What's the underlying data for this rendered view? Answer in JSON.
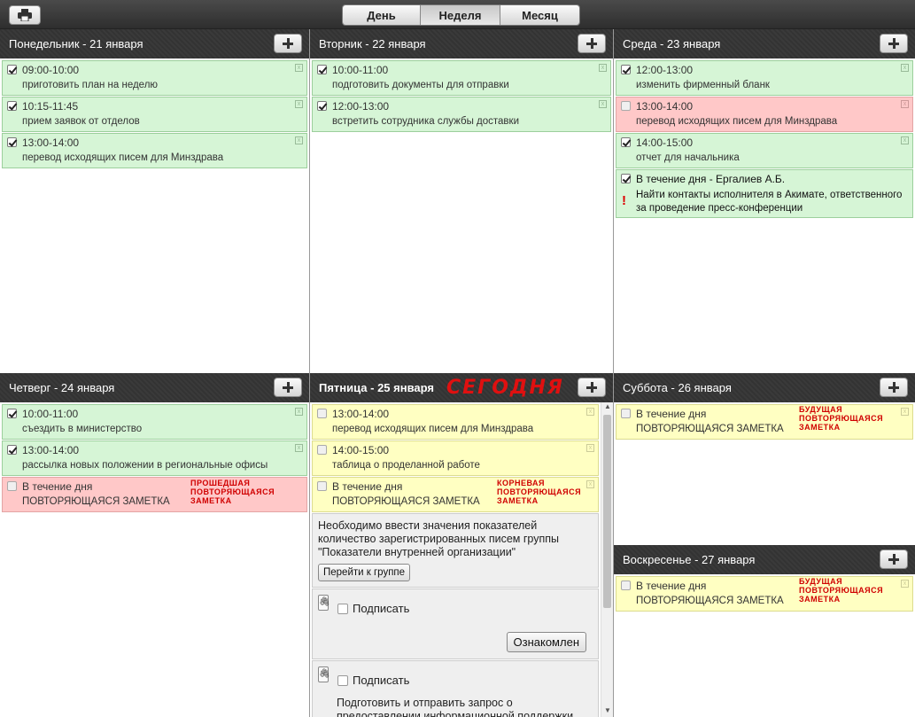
{
  "toolbar": {
    "views": [
      {
        "label": "День",
        "active": false
      },
      {
        "label": "Неделя",
        "active": true
      },
      {
        "label": "Месяц",
        "active": false
      }
    ]
  },
  "days": {
    "mon": {
      "title": "Понедельник - 21 января",
      "notes": [
        {
          "time": "09:00-10:00",
          "desc": "приготовить план на неделю"
        },
        {
          "time": "10:15-11:45",
          "desc": "прием заявок от отделов"
        },
        {
          "time": "13:00-14:00",
          "desc": "перевод исходящих писем для Минздрава"
        }
      ]
    },
    "tue": {
      "title": "Вторник - 22 января",
      "notes": [
        {
          "time": "10:00-11:00",
          "desc": "подготовить документы для отправки"
        },
        {
          "time": "12:00-13:00",
          "desc": "встретить сотрудника службы доставки"
        }
      ]
    },
    "wed": {
      "title": "Среда - 23 января",
      "notes": [
        {
          "time": "12:00-13:00",
          "desc": "изменить фирменный бланк"
        },
        {
          "time": "13:00-14:00",
          "desc": "перевод исходящих писем для Минздрава"
        },
        {
          "time": "14:00-15:00",
          "desc": "отчет для начальника"
        },
        {
          "time": "В течение дня - Ергалиев А.Б.",
          "desc": "Найти контакты исполнителя в Акимате, ответственного за проведение пресс-конференции"
        }
      ]
    },
    "thu": {
      "title": "Четверг - 24 января",
      "notes": [
        {
          "time": "10:00-11:00",
          "desc": "съездить в министерство"
        },
        {
          "time": "13:00-14:00",
          "desc": "рассылка новых положении в региональные офисы"
        },
        {
          "time": "В течение дня",
          "desc": "ПОВТОРЯЮЩАЯСЯ ЗАМЕТКА",
          "tag": [
            "ПРОШЕДШАЯ",
            "ПОВТОРЯЮЩАЯСЯ",
            "ЗАМЕТКА"
          ]
        }
      ]
    },
    "fri": {
      "title": "Пятница - 25 января",
      "today": "СЕГОДНЯ",
      "notes": [
        {
          "time": "13:00-14:00",
          "desc": "перевод исходящих писем для Минздрава"
        },
        {
          "time": "14:00-15:00",
          "desc": "таблица о проделанной работе"
        },
        {
          "time": "В течение дня",
          "desc": "ПОВТОРЯЮЩАЯСЯ ЗАМЕТКА",
          "tag": [
            "КОРНЕВАЯ",
            "ПОВТОРЯЮЩАЯСЯ",
            "ЗАМЕТКА"
          ]
        }
      ],
      "group_panel": {
        "text": "Необходимо ввести значения показателей количество зарегистрированных писем группы \"Показатели внутренней организации\"",
        "button": "Перейти к группе"
      },
      "sign_panel_1": {
        "checkbox": "Подписать",
        "button": "Ознакомлен"
      },
      "sign_panel_2": {
        "checkbox": "Подписать",
        "text": "Подготовить и отправить запрос о предоставлении информационной поддержки"
      }
    },
    "sat": {
      "title": "Суббота - 26 января",
      "notes": [
        {
          "time": "В течение дня",
          "desc": "ПОВТОРЯЮЩАЯСЯ ЗАМЕТКА",
          "tag": [
            "БУДУЩАЯ",
            "ПОВТОРЯЮЩАЯСЯ",
            "ЗАМЕТКА"
          ]
        }
      ]
    },
    "sun": {
      "title": "Воскресенье - 27 января",
      "notes": [
        {
          "time": "В течение дня",
          "desc": "ПОВТОРЯЮЩАЯСЯ ЗАМЕТКА",
          "tag": [
            "БУДУЩАЯ",
            "ПОВТОРЯЮЩАЯСЯ",
            "ЗАМЕТКА"
          ]
        }
      ]
    }
  },
  "colors": {
    "done": "#d6f5d6",
    "overdue": "#ffc8c8",
    "pending": "#ffffc2",
    "today_tag": "#e01010"
  }
}
